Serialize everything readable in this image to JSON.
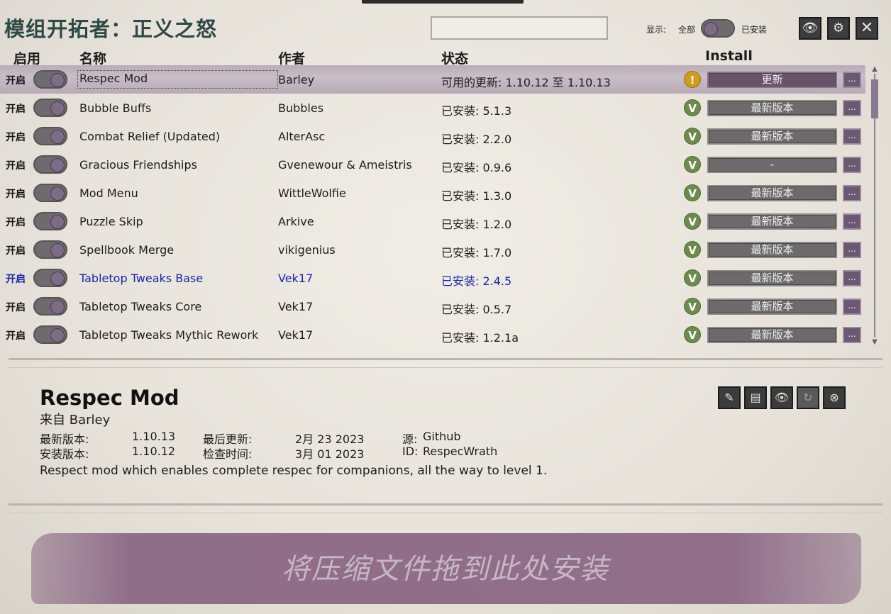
{
  "window": {
    "title": "模组开拓者：正义之怒"
  },
  "filter": {
    "search_value": "",
    "show_label": "显示:",
    "all_label": "全部",
    "installed_label": "已安装"
  },
  "toolbar": {
    "eye_icon": "eye-icon",
    "gear_icon": "gear-icon",
    "close_icon": "close-icon"
  },
  "columns": {
    "enable": "启用",
    "name": "名称",
    "author": "作者",
    "status": "状态",
    "install": "Install"
  },
  "mods": [
    {
      "on": "开启",
      "name": "Respec Mod",
      "author": "Barley",
      "status": "可用的更新:  1.10.12 至 1.10.13",
      "badge": "!",
      "action": "更新",
      "more": "...",
      "selected": true
    },
    {
      "on": "开启",
      "name": "Bubble Buffs",
      "author": "Bubbles",
      "status": "已安装: 5.1.3",
      "badge": "V",
      "action": "最新版本",
      "more": "..."
    },
    {
      "on": "开启",
      "name": "Combat Relief (Updated)",
      "author": "AlterAsc",
      "status": "已安装: 2.2.0",
      "badge": "V",
      "action": "最新版本",
      "more": "..."
    },
    {
      "on": "开启",
      "name": "Gracious Friendships",
      "author": "Gvenewour & Ameistris",
      "status": "已安装: 0.9.6",
      "badge": "V",
      "action": "-",
      "more": "..."
    },
    {
      "on": "开启",
      "name": "Mod Menu",
      "author": "WittleWolfie",
      "status": "已安装: 1.3.0",
      "badge": "V",
      "action": "最新版本",
      "more": "..."
    },
    {
      "on": "开启",
      "name": "Puzzle Skip",
      "author": "Arkive",
      "status": "已安装: 1.2.0",
      "badge": "V",
      "action": "最新版本",
      "more": "..."
    },
    {
      "on": "开启",
      "name": "Spellbook Merge",
      "author": "vikigenius",
      "status": "已安装: 1.7.0",
      "badge": "V",
      "action": "最新版本",
      "more": "..."
    },
    {
      "on": "开启",
      "name": "Tabletop Tweaks Base",
      "author": "Vek17",
      "status": "已安装: 2.4.5",
      "badge": "V",
      "action": "最新版本",
      "more": "...",
      "highlight": true
    },
    {
      "on": "开启",
      "name": "Tabletop Tweaks Core",
      "author": "Vek17",
      "status": "已安装: 0.5.7",
      "badge": "V",
      "action": "最新版本",
      "more": "..."
    },
    {
      "on": "开启",
      "name": "Tabletop Tweaks Mythic Rework",
      "author": "Vek17",
      "status": "已安装: 1.2.1a",
      "badge": "V",
      "action": "最新版本",
      "more": "..."
    }
  ],
  "details": {
    "title": "Respec Mod",
    "from": "来自 Barley",
    "latest_label": "最新版本:",
    "latest_value": "1.10.13",
    "installed_label": "安装版本:",
    "installed_value": "1.10.12",
    "updated_label": "最后更新:",
    "updated_value": "2月 23 2023",
    "checked_label": "检查时间:",
    "checked_value": "3月 01 2023",
    "source_label": "源:",
    "source_value": "Github",
    "id_label": "ID:",
    "id_value": "RespecWrath",
    "description": "Respect mod which enables complete respec for companions, all the way to level 1."
  },
  "dropzone": {
    "text": "将压缩文件拖到此处安装"
  }
}
